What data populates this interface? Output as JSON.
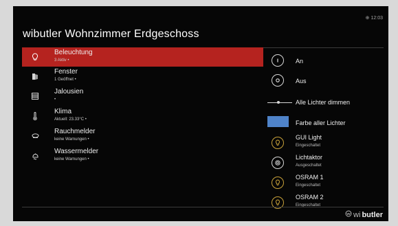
{
  "header": {
    "clock": "⊕ 12:03",
    "title": "wibutler Wohnzimmer Erdgeschoss"
  },
  "left_list": [
    {
      "label": "Beleuchtung",
      "sub": "3 Aktiv •",
      "icon": "bulb-icon",
      "selected": true
    },
    {
      "label": "Fenster",
      "sub": "1 Geöffnet •",
      "icon": "window-icon"
    },
    {
      "label": "Jalousien",
      "sub": "•",
      "icon": "blinds-icon"
    },
    {
      "label": "Klima",
      "sub": "Aktuell: 23.33°C •",
      "icon": "thermometer-icon"
    },
    {
      "label": "Rauchmelder",
      "sub": "keine Warnungen •",
      "icon": "smoke-detector-icon"
    },
    {
      "label": "Wassermelder",
      "sub": "keine Warnungen •",
      "icon": "water-sensor-icon"
    }
  ],
  "right_panel": {
    "on": "An",
    "off": "Aus",
    "dim_all": "Alle Lichter dimmen",
    "color_all": "Farbe aller Lichter",
    "color_swatch": "#4f83c9",
    "devices": [
      {
        "label": "GUI Light",
        "sub": "Eingeschaltet",
        "icon": "bulb-icon"
      },
      {
        "label": "Lichtaktor",
        "sub": "Ausgeschaltet",
        "icon": "light-actuator-icon"
      },
      {
        "label": "OSRAM 1",
        "sub": "Eingeschaltet",
        "icon": "bulb-icon"
      },
      {
        "label": "OSRAM 2",
        "sub": "Eingeschaltet",
        "icon": "bulb-icon"
      }
    ]
  },
  "brand": {
    "prefix": "wi",
    "strong": "butler"
  },
  "colors": {
    "selected": "#b5231f",
    "accent_gold": "#c9a23a"
  }
}
